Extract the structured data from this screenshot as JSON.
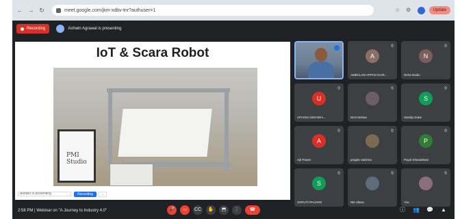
{
  "browser": {
    "url": "meet.google.com/jkm-xdbv-tnr?authuser=1",
    "update_label": "Update"
  },
  "topbar": {
    "recording_label": "Recording",
    "presenting_text": "Ashwin Agrawal is presenting"
  },
  "slide": {
    "title": "IoT & Scara Robot",
    "poster_text": "PMI Studio",
    "caption": "Ashwin is presenting",
    "button_label": "Recording",
    "button2_label": "..."
  },
  "participants": [
    {
      "name": "",
      "initial": "",
      "color": "#5b7a9c",
      "active": true
    },
    {
      "name": "AMBALAM APPAN NAIR...",
      "initial": "A",
      "color": "#8d6e63"
    },
    {
      "name": "Neha Naidu",
      "initial": "N",
      "color": "#7b5e57"
    },
    {
      "name": "UPASNA MOHIDIA...",
      "initial": "U",
      "color": "#d93025"
    },
    {
      "name": "Nimi Mohan",
      "initial": "",
      "color": "#6b5e69"
    },
    {
      "name": "Sandip Dube",
      "initial": "S",
      "color": "#0f9d58"
    },
    {
      "name": "Ajit Pawar",
      "initial": "A",
      "color": "#d93025"
    },
    {
      "name": "pragita Vaishna",
      "initial": "",
      "color": "#7a6a4f"
    },
    {
      "name": "Payal Khandelwal",
      "initial": "P",
      "color": "#2e7d32"
    },
    {
      "name": "SHRUTI PACHHE",
      "initial": "S",
      "color": "#0f9d58"
    },
    {
      "name": "NB Uttara",
      "initial": "",
      "color": "#5f6b7a"
    },
    {
      "name": "You",
      "initial": "",
      "color": "#8a6f7a"
    }
  ],
  "bottom": {
    "meeting_info": "2:58 PM | Webinar on \"A Journey to Industry 4.0\""
  },
  "icons": {
    "back": "←",
    "forward": "→",
    "reload": "↻",
    "mic": "🎤",
    "cam": "▭",
    "hand": "✋",
    "present": "⬒",
    "more": "⋮",
    "end": "☎",
    "info": "ⓘ",
    "people": "👥",
    "chat": "💬",
    "activities": "▲"
  },
  "colors": {
    "meet_bg": "#202124",
    "recording_red": "#d93025",
    "accent_blue": "#1a73e8"
  }
}
